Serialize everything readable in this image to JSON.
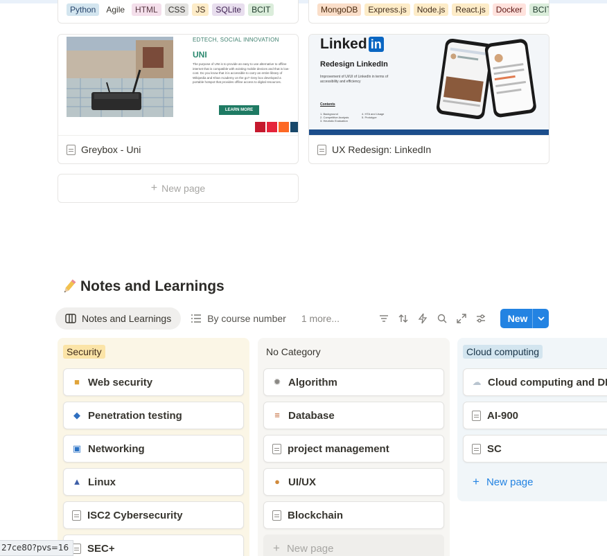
{
  "gallery": {
    "cards": [
      {
        "tags": [
          {
            "label": "Python",
            "bg": "#d3e5ef",
            "fg": "#28456c"
          },
          {
            "label": "Agile",
            "bg": "#ffffff",
            "fg": "#37352f"
          },
          {
            "label": "HTML",
            "bg": "#f4dfeb",
            "fg": "#5a3a44"
          },
          {
            "label": "CSS",
            "bg": "#e3e2e0",
            "fg": "#32302c"
          },
          {
            "label": "JS",
            "bg": "#fdecc8",
            "fg": "#402c1b"
          },
          {
            "label": "SQLite",
            "bg": "#e8deee",
            "fg": "#412454"
          },
          {
            "label": "BCIT",
            "bg": "#dbeddb",
            "fg": "#1c3829"
          }
        ],
        "title": "Greybox - Uni",
        "cover": {
          "category": "EDTECH, SOCIAL INNOVATION",
          "heading": "UNI",
          "body": "The purpose of UNI is to provide an easy to use alternative to offline internet that is compatible with existing mobile devices and that is low-cost. Do you know that it is accessible to carry an entire library of Wikipedia and Khan Academy on the go? Grey box developed a portable hotspot that provides offline access to digital resources.",
          "button": "LEARN MORE"
        }
      },
      {
        "tags": [
          {
            "label": "MongoDB",
            "bg": "#fadec9",
            "fg": "#49290e"
          },
          {
            "label": "Express.js",
            "bg": "#fdecc8",
            "fg": "#402c1b"
          },
          {
            "label": "Node.js",
            "bg": "#fdecc8",
            "fg": "#402c1b"
          },
          {
            "label": "React.js",
            "bg": "#fdecc8",
            "fg": "#402c1b"
          },
          {
            "label": "Docker",
            "bg": "#ffe2dd",
            "fg": "#5d1715"
          },
          {
            "label": "BCIT",
            "bg": "#dbeddb",
            "fg": "#1c3829"
          }
        ],
        "title": "UX Redesign: LinkedIn",
        "cover": {
          "brand": "Linked",
          "brand_in": "in",
          "heading": "Redesign LinkedIn",
          "sub": "Improvement of UI/UI of LinkedIn in terms of accessibility and efficiency",
          "contents": "Contents",
          "list": [
            "1. Background",
            "2. Competitive Analysis",
            "3. Heuristic Evaluation",
            "4. HTA and Usage",
            "5. Prototype"
          ]
        }
      }
    ],
    "new_page": "New page"
  },
  "section": {
    "title": "Notes and Learnings",
    "title_icon": "pencil-icon",
    "views": [
      {
        "label": "Notes and Learnings",
        "icon": "board-icon",
        "active": true
      },
      {
        "label": "By course number",
        "icon": "list-icon",
        "active": false
      }
    ],
    "more": "1 more...",
    "tools": [
      "filter-icon",
      "sort-icon",
      "automation-icon",
      "search-icon",
      "expand-icon",
      "settings-icon"
    ],
    "new_button": "New"
  },
  "board": {
    "columns": [
      {
        "name": "Security",
        "tag_bg": "#fbe4a7",
        "bg": "#fbf6e6",
        "items": [
          {
            "title": "Web security",
            "icon": "lock-icon"
          },
          {
            "title": "Penetration testing",
            "icon": "shield-icon"
          },
          {
            "title": "Networking",
            "icon": "chart-icon"
          },
          {
            "title": "Linux",
            "icon": "penguin-icon"
          },
          {
            "title": "ISC2 Cybersecurity",
            "icon": "page-icon"
          },
          {
            "title": "SEC+",
            "icon": "page-icon"
          }
        ]
      },
      {
        "name": "No Category",
        "tag_bg": "",
        "bg": "#f7f6f3",
        "items": [
          {
            "title": "Algorithm",
            "icon": "sparkle-icon"
          },
          {
            "title": "Database",
            "icon": "books-icon"
          },
          {
            "title": "project management",
            "icon": "page-icon"
          },
          {
            "title": "UI/UX",
            "icon": "palette-icon"
          },
          {
            "title": "Blockchain",
            "icon": "page-icon"
          }
        ],
        "new_page": "New page"
      },
      {
        "name": "Cloud computing",
        "tag_bg": "#d3e5ef",
        "bg": "#f1f6f9",
        "items": [
          {
            "title": "Cloud computing and DF",
            "icon": "cloud-icon"
          },
          {
            "title": "AI-900",
            "icon": "page-icon"
          },
          {
            "title": "SC",
            "icon": "page-icon"
          }
        ],
        "new_page": "New page"
      }
    ]
  },
  "status_url": "27ce80?pvs=16",
  "colors": {
    "accent": "#2383e2",
    "text": "#37352f",
    "muted": "#8a8884"
  }
}
